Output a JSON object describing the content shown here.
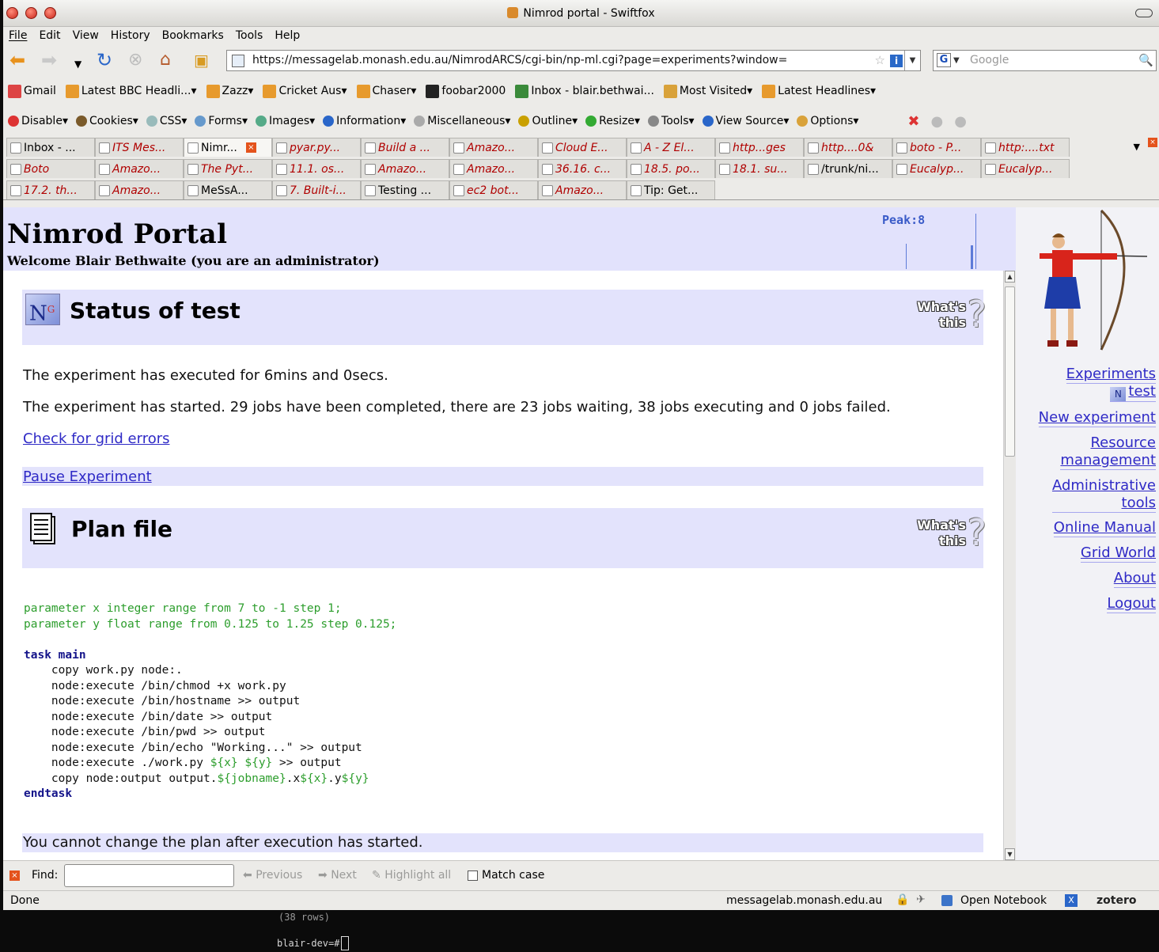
{
  "window": {
    "title": "Nimrod portal - Swiftfox"
  },
  "menu": [
    "File",
    "Edit",
    "View",
    "History",
    "Bookmarks",
    "Tools",
    "Help"
  ],
  "nav": {
    "url": "https://messagelab.monash.edu.au/NimrodARCS/cgi-bin/np-ml.cgi?page=experiments?window=",
    "search_placeholder": "Google"
  },
  "bookmarks": [
    {
      "label": "Gmail",
      "icon": "gmail-icon"
    },
    {
      "label": "Latest BBC Headli...",
      "icon": "feed-icon",
      "dropdown": true
    },
    {
      "label": "Zazz",
      "icon": "feed-icon",
      "dropdown": true
    },
    {
      "label": "Cricket Aus",
      "icon": "feed-icon",
      "dropdown": true
    },
    {
      "label": "Chaser",
      "icon": "feed-icon",
      "dropdown": true
    },
    {
      "label": "foobar2000",
      "icon": "foobar-icon"
    },
    {
      "label": "Inbox - blair.bethwai...",
      "icon": "google-icon"
    },
    {
      "label": "Most Visited",
      "icon": "folder-icon",
      "dropdown": true
    },
    {
      "label": "Latest Headlines",
      "icon": "feed-icon",
      "dropdown": true
    }
  ],
  "devtools": [
    "Disable",
    "Cookies",
    "CSS",
    "Forms",
    "Images",
    "Information",
    "Miscellaneous",
    "Outline",
    "Resize",
    "Tools",
    "View Source",
    "Options"
  ],
  "tabs": {
    "row1": [
      {
        "label": "Inbox - ...",
        "italic": false
      },
      {
        "label": "ITS Mes...",
        "italic": true
      },
      {
        "label": "Nimr...",
        "italic": false,
        "selected": true
      },
      {
        "label": "pyar.py...",
        "italic": true
      },
      {
        "label": "Build a ...",
        "italic": true
      },
      {
        "label": "Amazo...",
        "italic": true
      },
      {
        "label": "Cloud E...",
        "italic": true
      },
      {
        "label": "A - Z El...",
        "italic": true
      },
      {
        "label": "http...ges",
        "italic": true
      },
      {
        "label": "http....0&",
        "italic": true
      },
      {
        "label": "boto - P...",
        "italic": true
      },
      {
        "label": "http:....txt",
        "italic": true
      }
    ],
    "row2": [
      {
        "label": "Boto",
        "italic": true
      },
      {
        "label": "Amazo...",
        "italic": true
      },
      {
        "label": "The Pyt...",
        "italic": true
      },
      {
        "label": "11.1. os...",
        "italic": true
      },
      {
        "label": "Amazo...",
        "italic": true
      },
      {
        "label": "Amazo...",
        "italic": true
      },
      {
        "label": "36.16. c...",
        "italic": true
      },
      {
        "label": "18.5. po...",
        "italic": true
      },
      {
        "label": "18.1. su...",
        "italic": true
      },
      {
        "label": "/trunk/ni...",
        "italic": false
      },
      {
        "label": "Eucalyp...",
        "italic": true
      },
      {
        "label": "Eucalyp...",
        "italic": true
      }
    ],
    "row3": [
      {
        "label": "17.2. th...",
        "italic": true
      },
      {
        "label": "Amazo...",
        "italic": true
      },
      {
        "label": "MeSsA...",
        "italic": false
      },
      {
        "label": "7. Built-i...",
        "italic": true
      },
      {
        "label": "Testing ...",
        "italic": false
      },
      {
        "label": "ec2 bot...",
        "italic": true
      },
      {
        "label": "Amazo...",
        "italic": true
      },
      {
        "label": "Tip: Get...",
        "italic": false
      }
    ]
  },
  "portal": {
    "title": "Nimrod Portal",
    "welcome": "Welcome Blair Bethwaite (you are an administrator)",
    "peak": "Peak:8"
  },
  "status": {
    "heading": "Status of test",
    "whats_this": [
      "What's",
      "this"
    ],
    "line1": "The experiment has executed for 6mins and 0secs.",
    "line2": "The experiment has started. 29 jobs have been completed, there are 23 jobs waiting, 38 jobs executing and 0 jobs failed.",
    "grid_link": "Check for grid errors",
    "pause_link": "Pause Experiment",
    "jobs": {
      "completed": 29,
      "waiting": 23,
      "executing": 38,
      "failed": 0
    }
  },
  "plan": {
    "heading": "Plan file",
    "note": "You cannot change the plan after execution has started."
  },
  "sidebar": {
    "experiments": "Experiments",
    "test": "test",
    "new_experiment": "New experiment",
    "resource": [
      "Resource",
      "management"
    ],
    "admin": [
      "Administrative",
      "tools"
    ],
    "manual": "Online Manual",
    "grid_world": "Grid World",
    "about": "About",
    "logout": "Logout"
  },
  "findbar": {
    "label": "Find:",
    "previous": "Previous",
    "next": "Next",
    "highlight": "Highlight all",
    "match_case": "Match case"
  },
  "statusbar": {
    "done": "Done",
    "host": "messagelab.monash.edu.au",
    "notebook": "Open Notebook",
    "zotero": "zotero"
  },
  "terminal": {
    "line1": "(38 rows)",
    "prompt": "blair-dev=#"
  }
}
